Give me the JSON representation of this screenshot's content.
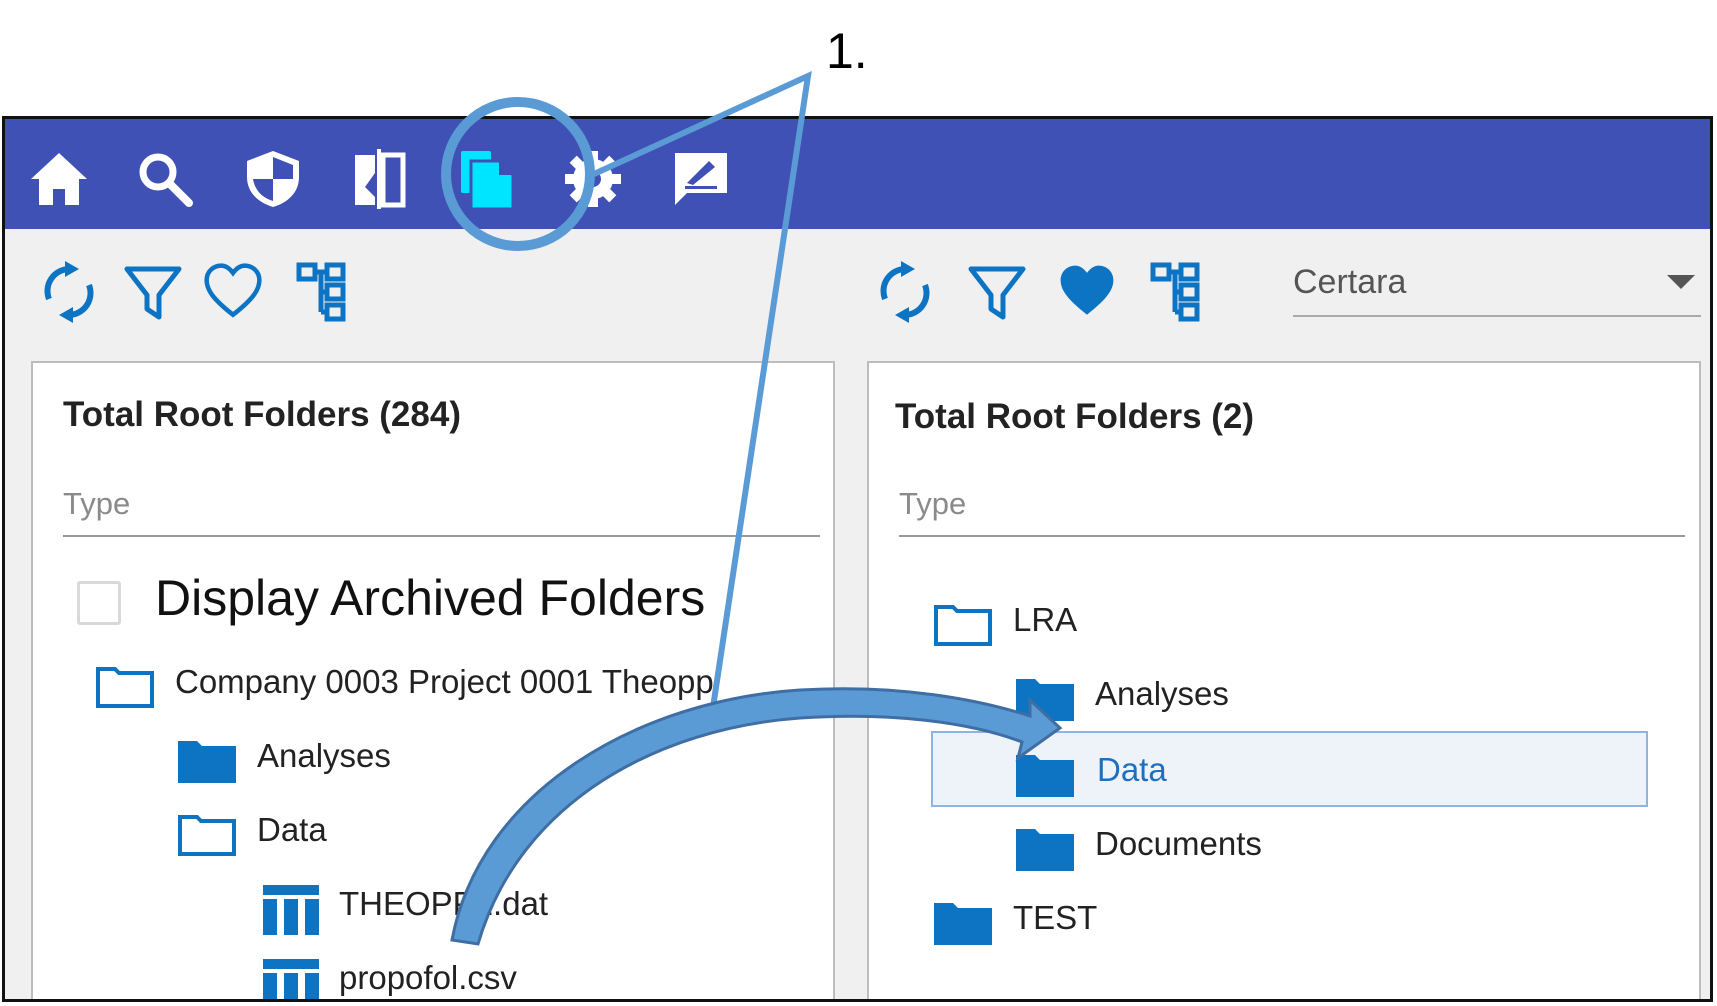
{
  "callout": {
    "number": "1."
  },
  "colors": {
    "header": "#3f51b5",
    "accent_cyan": "#00e5ff",
    "icon_blue": "#0d74c4",
    "callout_blue": "#5b9bd5",
    "callout_dark": "#3e6ea3",
    "selected_bg": "#eef3fa",
    "selected_border": "#8fb4e3"
  },
  "nav": {
    "icons": [
      "home-icon",
      "search-icon",
      "shield-icon",
      "compare-icon",
      "files-icon",
      "gear-icon",
      "signature-icon"
    ],
    "active": "files-icon"
  },
  "left_panel": {
    "toolbar_icons": [
      "refresh-icon",
      "filter-icon",
      "heart-outline-icon",
      "hierarchy-icon"
    ],
    "title": "Total Root Folders (284)",
    "type_placeholder": "Type",
    "archived_checkbox_label": "Display Archived Folders",
    "archived_checkbox_checked": false,
    "tree": [
      {
        "label": "Company 0003 Project 0001 Theopp",
        "icon": "folder-open-icon"
      },
      {
        "label": "Analyses",
        "icon": "folder-icon"
      },
      {
        "label": "Data",
        "icon": "folder-open-icon"
      },
      {
        "label": "THEOPP2.dat",
        "icon": "table-file-icon"
      },
      {
        "label": "propofol.csv",
        "icon": "table-file-icon"
      }
    ]
  },
  "right_panel": {
    "toolbar_icons": [
      "refresh-icon",
      "filter-icon",
      "heart-filled-icon",
      "hierarchy-icon"
    ],
    "tenant_select": {
      "value": "Certara"
    },
    "title": "Total Root Folders (2)",
    "type_placeholder": "Type",
    "tree": [
      {
        "label": "LRA",
        "icon": "folder-open-icon"
      },
      {
        "label": "Analyses",
        "icon": "folder-icon"
      },
      {
        "label": "Data",
        "icon": "folder-icon",
        "selected": true
      },
      {
        "label": "Documents",
        "icon": "folder-icon"
      },
      {
        "label": "TEST",
        "icon": "folder-icon"
      }
    ]
  }
}
